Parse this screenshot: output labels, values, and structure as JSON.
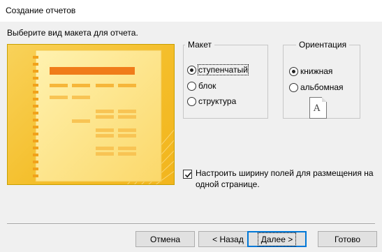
{
  "window": {
    "title": "Создание отчетов"
  },
  "prompt": "Выберите вид макета для отчета.",
  "layout_group": {
    "label": "Макет",
    "options": [
      "ступенчатый",
      "блок",
      "структура"
    ],
    "selected": "ступенчатый"
  },
  "orientation_group": {
    "label": "Ориентация",
    "options": [
      "книжная",
      "альбомная"
    ],
    "selected": "книжная",
    "page_icon_letter": "A"
  },
  "fit_checkbox": {
    "label": "Настроить ширину полей для размещения на одной странице.",
    "checked": true
  },
  "buttons": {
    "cancel": "Отмена",
    "back": "< Назад",
    "next": "Далее >",
    "finish": "Готово"
  },
  "colors": {
    "preview_bg": "#f4be2a",
    "preview_bar": "#f07c1a",
    "accent_blue": "#0078d7"
  }
}
